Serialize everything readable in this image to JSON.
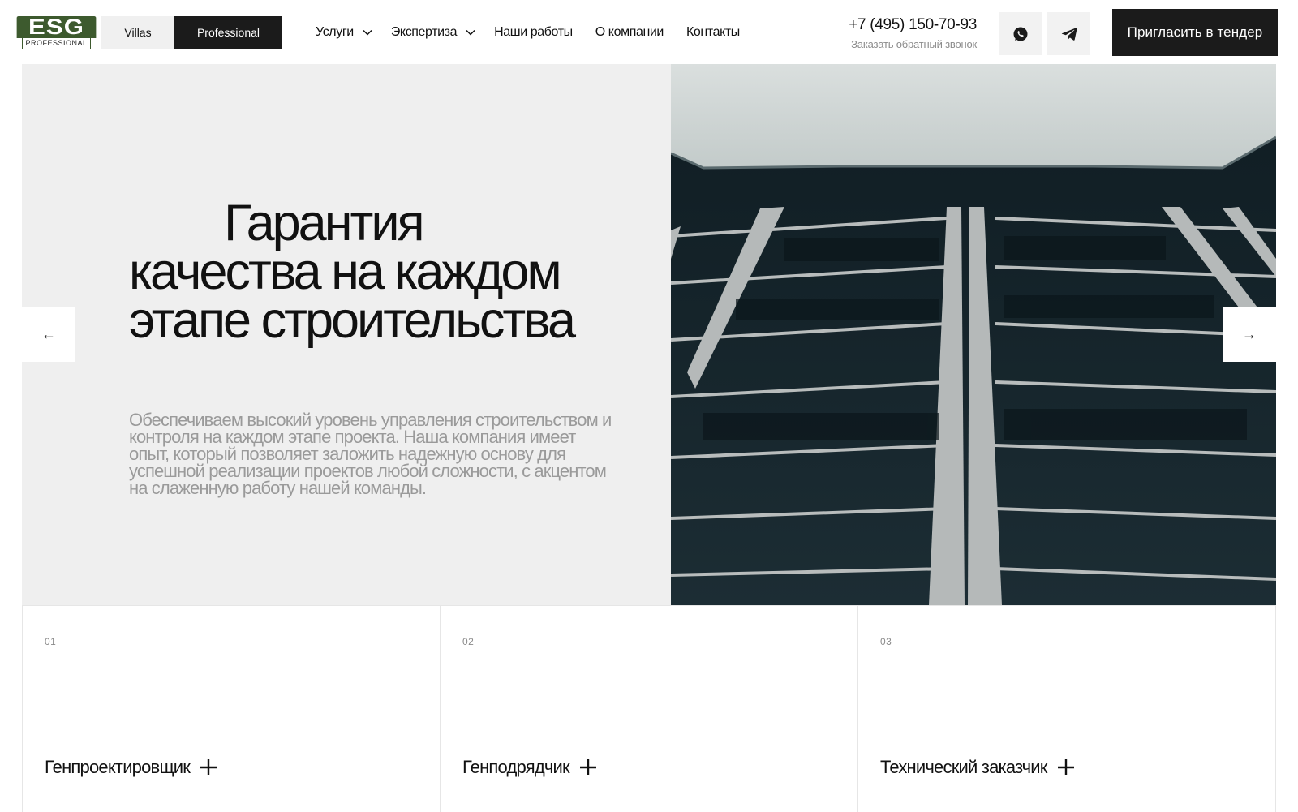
{
  "brand": {
    "logo_main": "ESG",
    "logo_sub": "PROFESSIONAL",
    "logo_color": "#3d5a2e"
  },
  "segment": {
    "villas": "Villas",
    "professional": "Professional",
    "active": "professional"
  },
  "nav": {
    "items": [
      {
        "label": "Услуги",
        "has_dropdown": true
      },
      {
        "label": "Экспертиза",
        "has_dropdown": true
      },
      {
        "label": "Наши работы",
        "has_dropdown": false
      },
      {
        "label": "О компании",
        "has_dropdown": false
      },
      {
        "label": "Контакты",
        "has_dropdown": false
      }
    ]
  },
  "contact": {
    "phone": "+7 (495) 150-70-93",
    "callback": "Заказать обратный звонок",
    "icons": [
      "whatsapp-icon",
      "telegram-icon"
    ]
  },
  "cta": {
    "label": "Пригласить в тендер"
  },
  "hero": {
    "title_line1": "Гарантия",
    "title_line2": "качества на каждом",
    "title_line3": "этапе строительства",
    "description": "Обеспечиваем высокий уровень управления строительством и контроля на каждом этапе проекта. Наша компания имеет опыт, который позволяет заложить надежную основу для успешной реализации проектов любой сложности, с акцентом на слаженную работу нашей команды.",
    "prev_arrow": "←",
    "next_arrow": "→",
    "image_subject": "building-facade-photo"
  },
  "cards": [
    {
      "num": "01",
      "title": "Генпроектировщик",
      "icon": "plus-icon"
    },
    {
      "num": "02",
      "title": "Генподрядчик",
      "icon": "plus-icon"
    },
    {
      "num": "03",
      "title": "Технический заказчик",
      "icon": "plus-icon"
    }
  ],
  "colors": {
    "dark": "#1b1b1b",
    "hero_bg": "#efefef",
    "muted_text": "#9a9a9a"
  }
}
